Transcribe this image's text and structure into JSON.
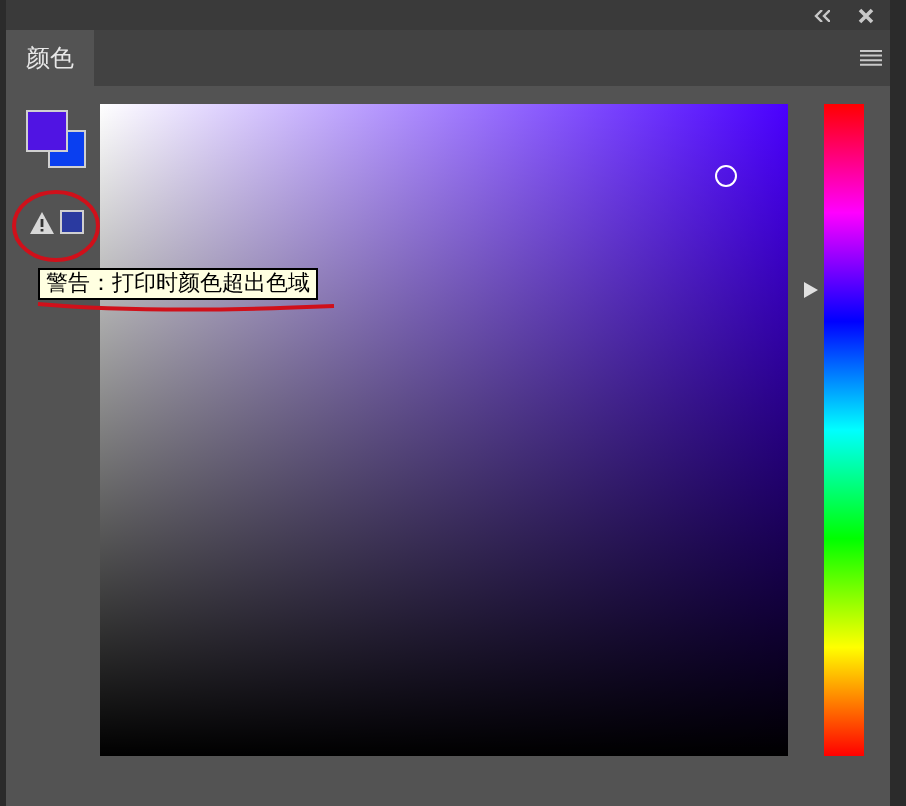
{
  "tabs": [
    {
      "label": "颜色",
      "selected": true
    }
  ],
  "gamut_warning": {
    "tooltip": "警告：打印时颜色超出色域"
  },
  "picker": {
    "saturation": {
      "level": 0.91
    },
    "brightness": {
      "level": 0.89
    },
    "hue": {
      "level": 0.715
    }
  }
}
